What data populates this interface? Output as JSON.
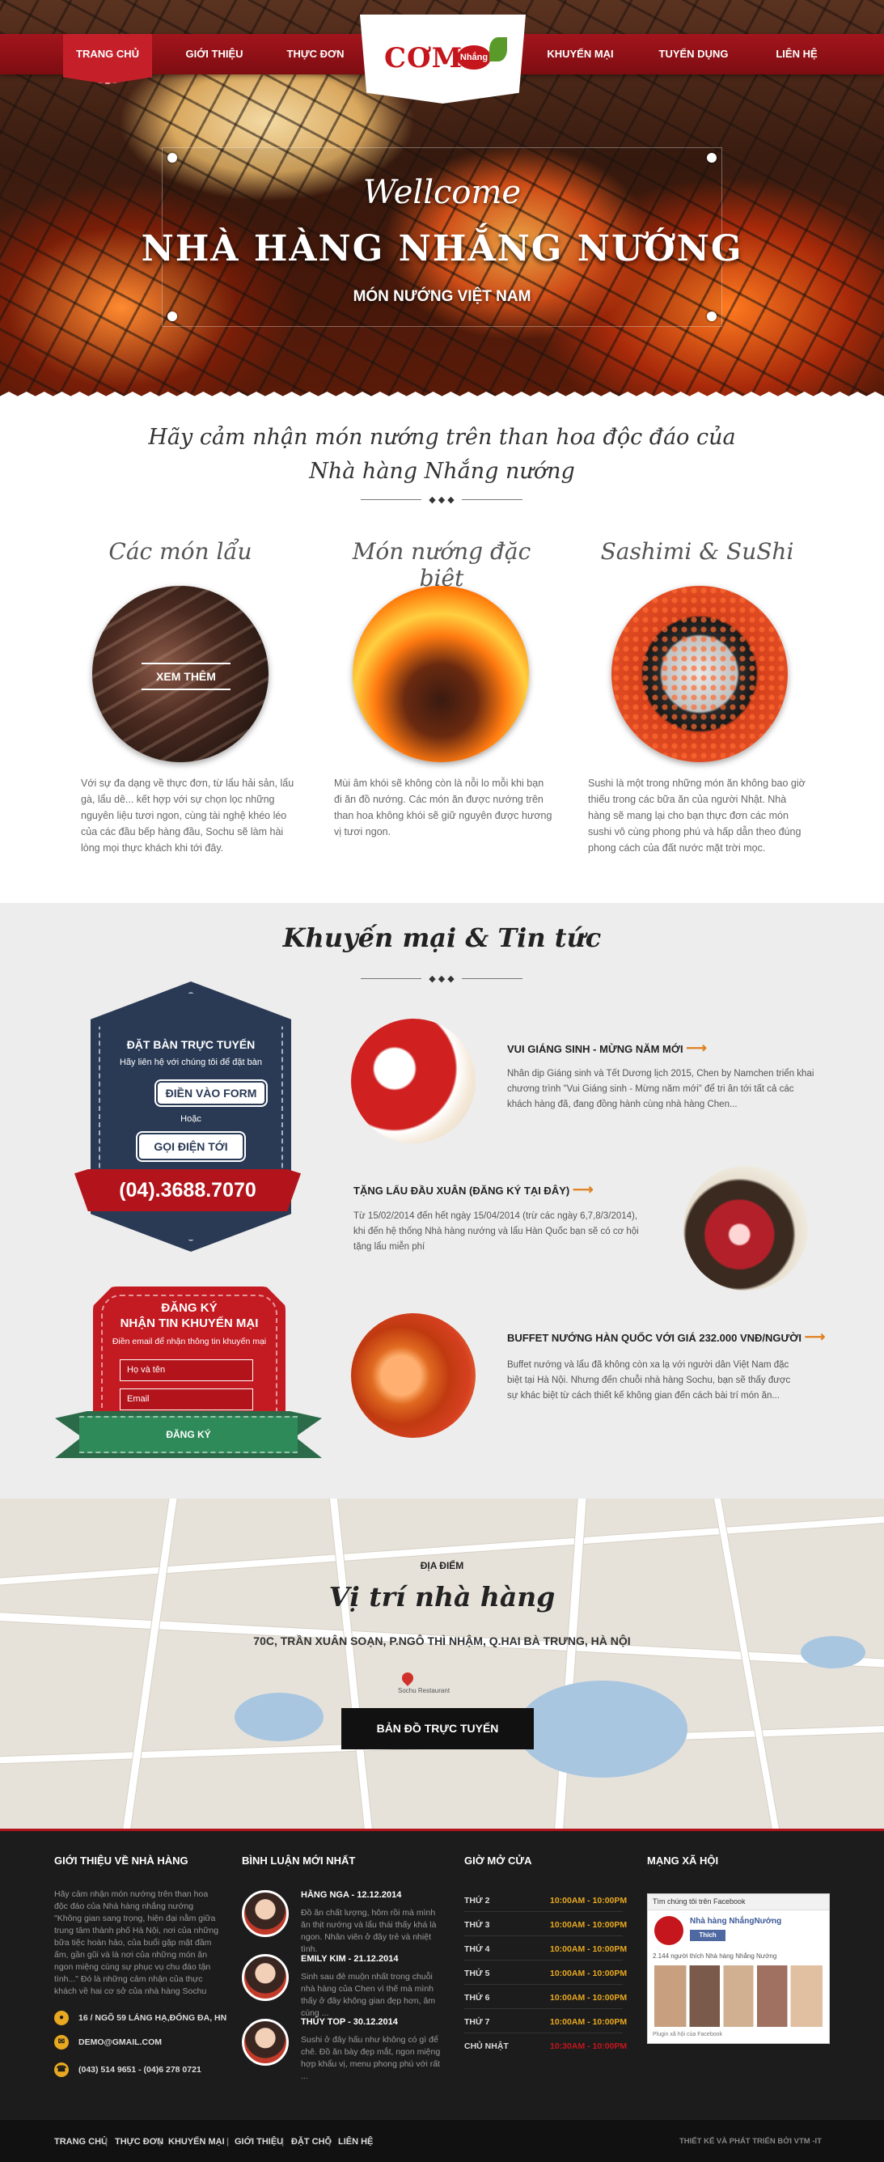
{
  "nav": {
    "items": [
      "TRANG CHỦ",
      "GIỚI THIỆU",
      "THỰC ĐƠN",
      "KHUYẾN MẠI",
      "TUYỂN DỤNG",
      "LIÊN HỆ"
    ]
  },
  "logo": {
    "text": "CƠM",
    "badge": "Nhắng"
  },
  "hero": {
    "welcome": "Wellcome",
    "title": "NHÀ HÀNG NHẮNG NƯỚNG",
    "subtitle": "MÓN NƯỚNG VIỆT NAM"
  },
  "intro": {
    "line1": "Hãy cảm nhận món nướng trên than hoa độc đáo của",
    "line2": "Nhà hàng Nhắng nướng"
  },
  "divider_glyph": "◆ ◆ ◆",
  "features": [
    {
      "title": "Các món lẩu",
      "button": "XEM THÊM",
      "text": "Với sự đa dạng về thực đơn, từ lẩu hải sản, lẩu gà, lẩu dê... kết hợp với sự chọn lọc những nguyên liệu tươi ngon, cùng tài nghệ khéo léo của các đầu bếp hàng đầu, Sochu sẽ làm hài lòng mọi thực khách khi tới đây."
    },
    {
      "title": "Món nướng đặc biệt",
      "text": "Mùi âm khói sẽ không còn là nỗi lo mỗi khi bạn đi ăn đồ nướng. Các món ăn được nướng trên than hoa không khói sẽ giữ nguyên được hương vị tươi ngon."
    },
    {
      "title": "Sashimi & SuShi",
      "text": "Sushi là một trong những món ăn không bao giờ thiếu trong các bữa ăn của người Nhật. Nhà hàng sẽ mang lại cho bạn thực đơn các món sushi vô cùng phong phú và hấp dẫn theo đúng phong cách của đất nước mặt trời mọc."
    }
  ],
  "promo": {
    "title": "Khuyến mại & Tin tức"
  },
  "booking": {
    "title": "ĐẶT BÀN TRỰC TUYẾN",
    "subtitle": "Hãy liên hệ với chúng tôi để đặt bàn",
    "form_button": "ĐIỀN VÀO FORM",
    "or": "Hoặc",
    "call_button": "GỌI ĐIỆN TỚI",
    "phone": "(04).3688.7070"
  },
  "signup": {
    "title1": "ĐĂNG KÝ",
    "title2": "NHẬN TIN KHUYẾN MẠI",
    "subtitle": "Điền email để nhận thông tin khuyến mại",
    "name_placeholder": "Họ và tên",
    "email_placeholder": "Email",
    "button": "ĐĂNG KÝ"
  },
  "news": [
    {
      "title": "VUI GIÁNG SINH - MỪNG NĂM MỚI",
      "text": "Nhân dịp Giáng sinh và Tết Dương lịch 2015, Chen by Namchen triển khai chương trình \"Vui Giáng sinh - Mừng năm mới\" để tri ân tới tất cả các khách hàng đã, đang đồng hành cùng nhà hàng Chen..."
    },
    {
      "title": "TẶNG LẨU ĐẦU XUÂN (ĐĂNG KÝ TẠI ĐÂY)",
      "text": "Từ 15/02/2014 đến hết ngày 15/04/2014 (trừ các ngày 6,7,8/3/2014), khi đến hệ thống Nhà hàng nướng và lẩu Hàn Quốc bạn sẽ có cơ hội tặng lẩu miễn phí"
    },
    {
      "title": "BUFFET NƯỚNG HÀN QUỐC VỚI GIÁ 232.000 VNĐ/NGƯỜI",
      "text": "Buffet nướng và lẩu đã không còn xa lạ với người dân Việt Nam đặc biệt tại Hà Nội. Nhưng đến chuỗi nhà hàng Sochu, bạn sẽ thấy được sự khác biệt từ cách thiết kế không gian đến cách bài trí món ăn..."
    }
  ],
  "map": {
    "label": "ĐỊA ĐIỂM",
    "title": "Vị trí nhà hàng",
    "address": "70C, TRẦN XUÂN SOẠN, P.NGÔ THÌ NHẬM, Q.HAI BÀ TRƯNG, HÀ NỘI",
    "button": "BẢN ĐỒ TRỰC TUYẾN",
    "marker": "Sochu Restaurant"
  },
  "footer": {
    "about_title": "GIỚI THIỆU VỀ NHÀ HÀNG",
    "about_text": "Hãy cảm nhận món nướng trên than hoa độc đáo của Nhà hàng nhắng nướng \"Không gian sang trọng, hiện đại nằm giữa trung tâm thành phố Hà Nội, nơi của những bữa tiệc hoàn hảo, của buổi gặp mặt đầm ấm, gần gũi và là nơi của những món ăn ngon miệng cùng sự phục vụ chu đáo tận tình...\" Đó là những cảm nhận của thực khách về hai cơ sở của nhà hàng Sochu",
    "address": "16 / NGÕ 59 LÁNG HẠ,ĐỐNG ĐA, HN",
    "email": "DEMO@GMAIL.COM",
    "phone": "(043) 514 9651 - (04)6 278 0721",
    "comments_title": "BÌNH LUẬN MỚI NHẤT",
    "comments": [
      {
        "name": "HẰNG NGA - 12.12.2014",
        "text": "Đồ ăn chất lượng, hôm rồi mà mình ăn thịt nướng và lẩu thái thấy khá là ngon. Nhân viên ở đây trẻ và nhiệt tình."
      },
      {
        "name": "EMILY KIM - 21.12.2014",
        "text": "Sinh sau đẻ muộn nhất trong chuỗi nhà hàng của Chen vì thế mà mình thấy ở đây không gian đẹp hơn, âm cúng ..."
      },
      {
        "name": "THÚY TOP - 30.12.2014",
        "text": "Sushi ở đây hấu như không có gì để chê. Đồ ăn bày đẹp mắt, ngon miệng hợp khẩu vị, menu phong phú với rất ..."
      }
    ],
    "hours_title": "GIỜ MỞ CỬA",
    "hours": [
      {
        "day": "THỨ 2",
        "time": "10:00AM - 10:00PM"
      },
      {
        "day": "THỨ 3",
        "time": "10:00AM - 10:00PM"
      },
      {
        "day": "THỨ 4",
        "time": "10:00AM - 10:00PM"
      },
      {
        "day": "THỨ 5",
        "time": "10:00AM - 10:00PM"
      },
      {
        "day": "THỨ 6",
        "time": "10:00AM - 10:00PM"
      },
      {
        "day": "THỨ 7",
        "time": "10:00AM - 10:00PM"
      },
      {
        "day": "CHỦ NHẬT",
        "time": "10:30AM - 10:00PM"
      }
    ],
    "social_title": "MẠNG XÃ HỘI",
    "fb": {
      "header": "Tìm chúng tôi trên Facebook",
      "page": "Nhà hàng NhắngNướng",
      "like": "Thích",
      "count": "2.144 người thích Nhà hàng Nhắng Nướng",
      "plugin": "Plugin xã hội của Facebook"
    }
  },
  "bottom": {
    "links": [
      "TRANG CHỦ",
      "THỰC ĐƠN",
      "KHUYẾN MẠI",
      "GIỚI THIỆU",
      "ĐẶT CHỖ",
      "LIÊN HỆ"
    ],
    "credit": "THIẾT KẾ VÀ PHÁT TRIỂN BỞI VTM -IT"
  },
  "colors": {
    "brand_red": "#b3141c",
    "navy": "#2a3a55",
    "gold": "#e8a820",
    "green": "#2f8a5a"
  }
}
